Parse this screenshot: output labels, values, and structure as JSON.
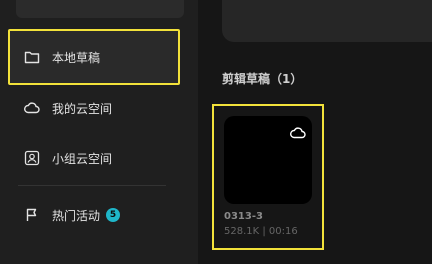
{
  "sidebar": {
    "items": [
      {
        "label": "本地草稿",
        "icon": "folder-icon",
        "active": true
      },
      {
        "label": "我的云空间",
        "icon": "cloud-icon"
      },
      {
        "label": "小组云空间",
        "icon": "group-cloud-icon"
      },
      {
        "label": "热门活动",
        "icon": "flag-icon",
        "badge": "5"
      }
    ]
  },
  "main": {
    "section_title": "剪辑草稿（1）",
    "drafts": [
      {
        "name": "0313-3",
        "size": "528.1K",
        "duration": "00:16",
        "meta": "528.1K | 00:16"
      }
    ]
  },
  "colors": {
    "highlight": "#f2e13a",
    "badge": "#1fb6c9",
    "background": "#121212",
    "sidebar": "#1f1f1f"
  }
}
